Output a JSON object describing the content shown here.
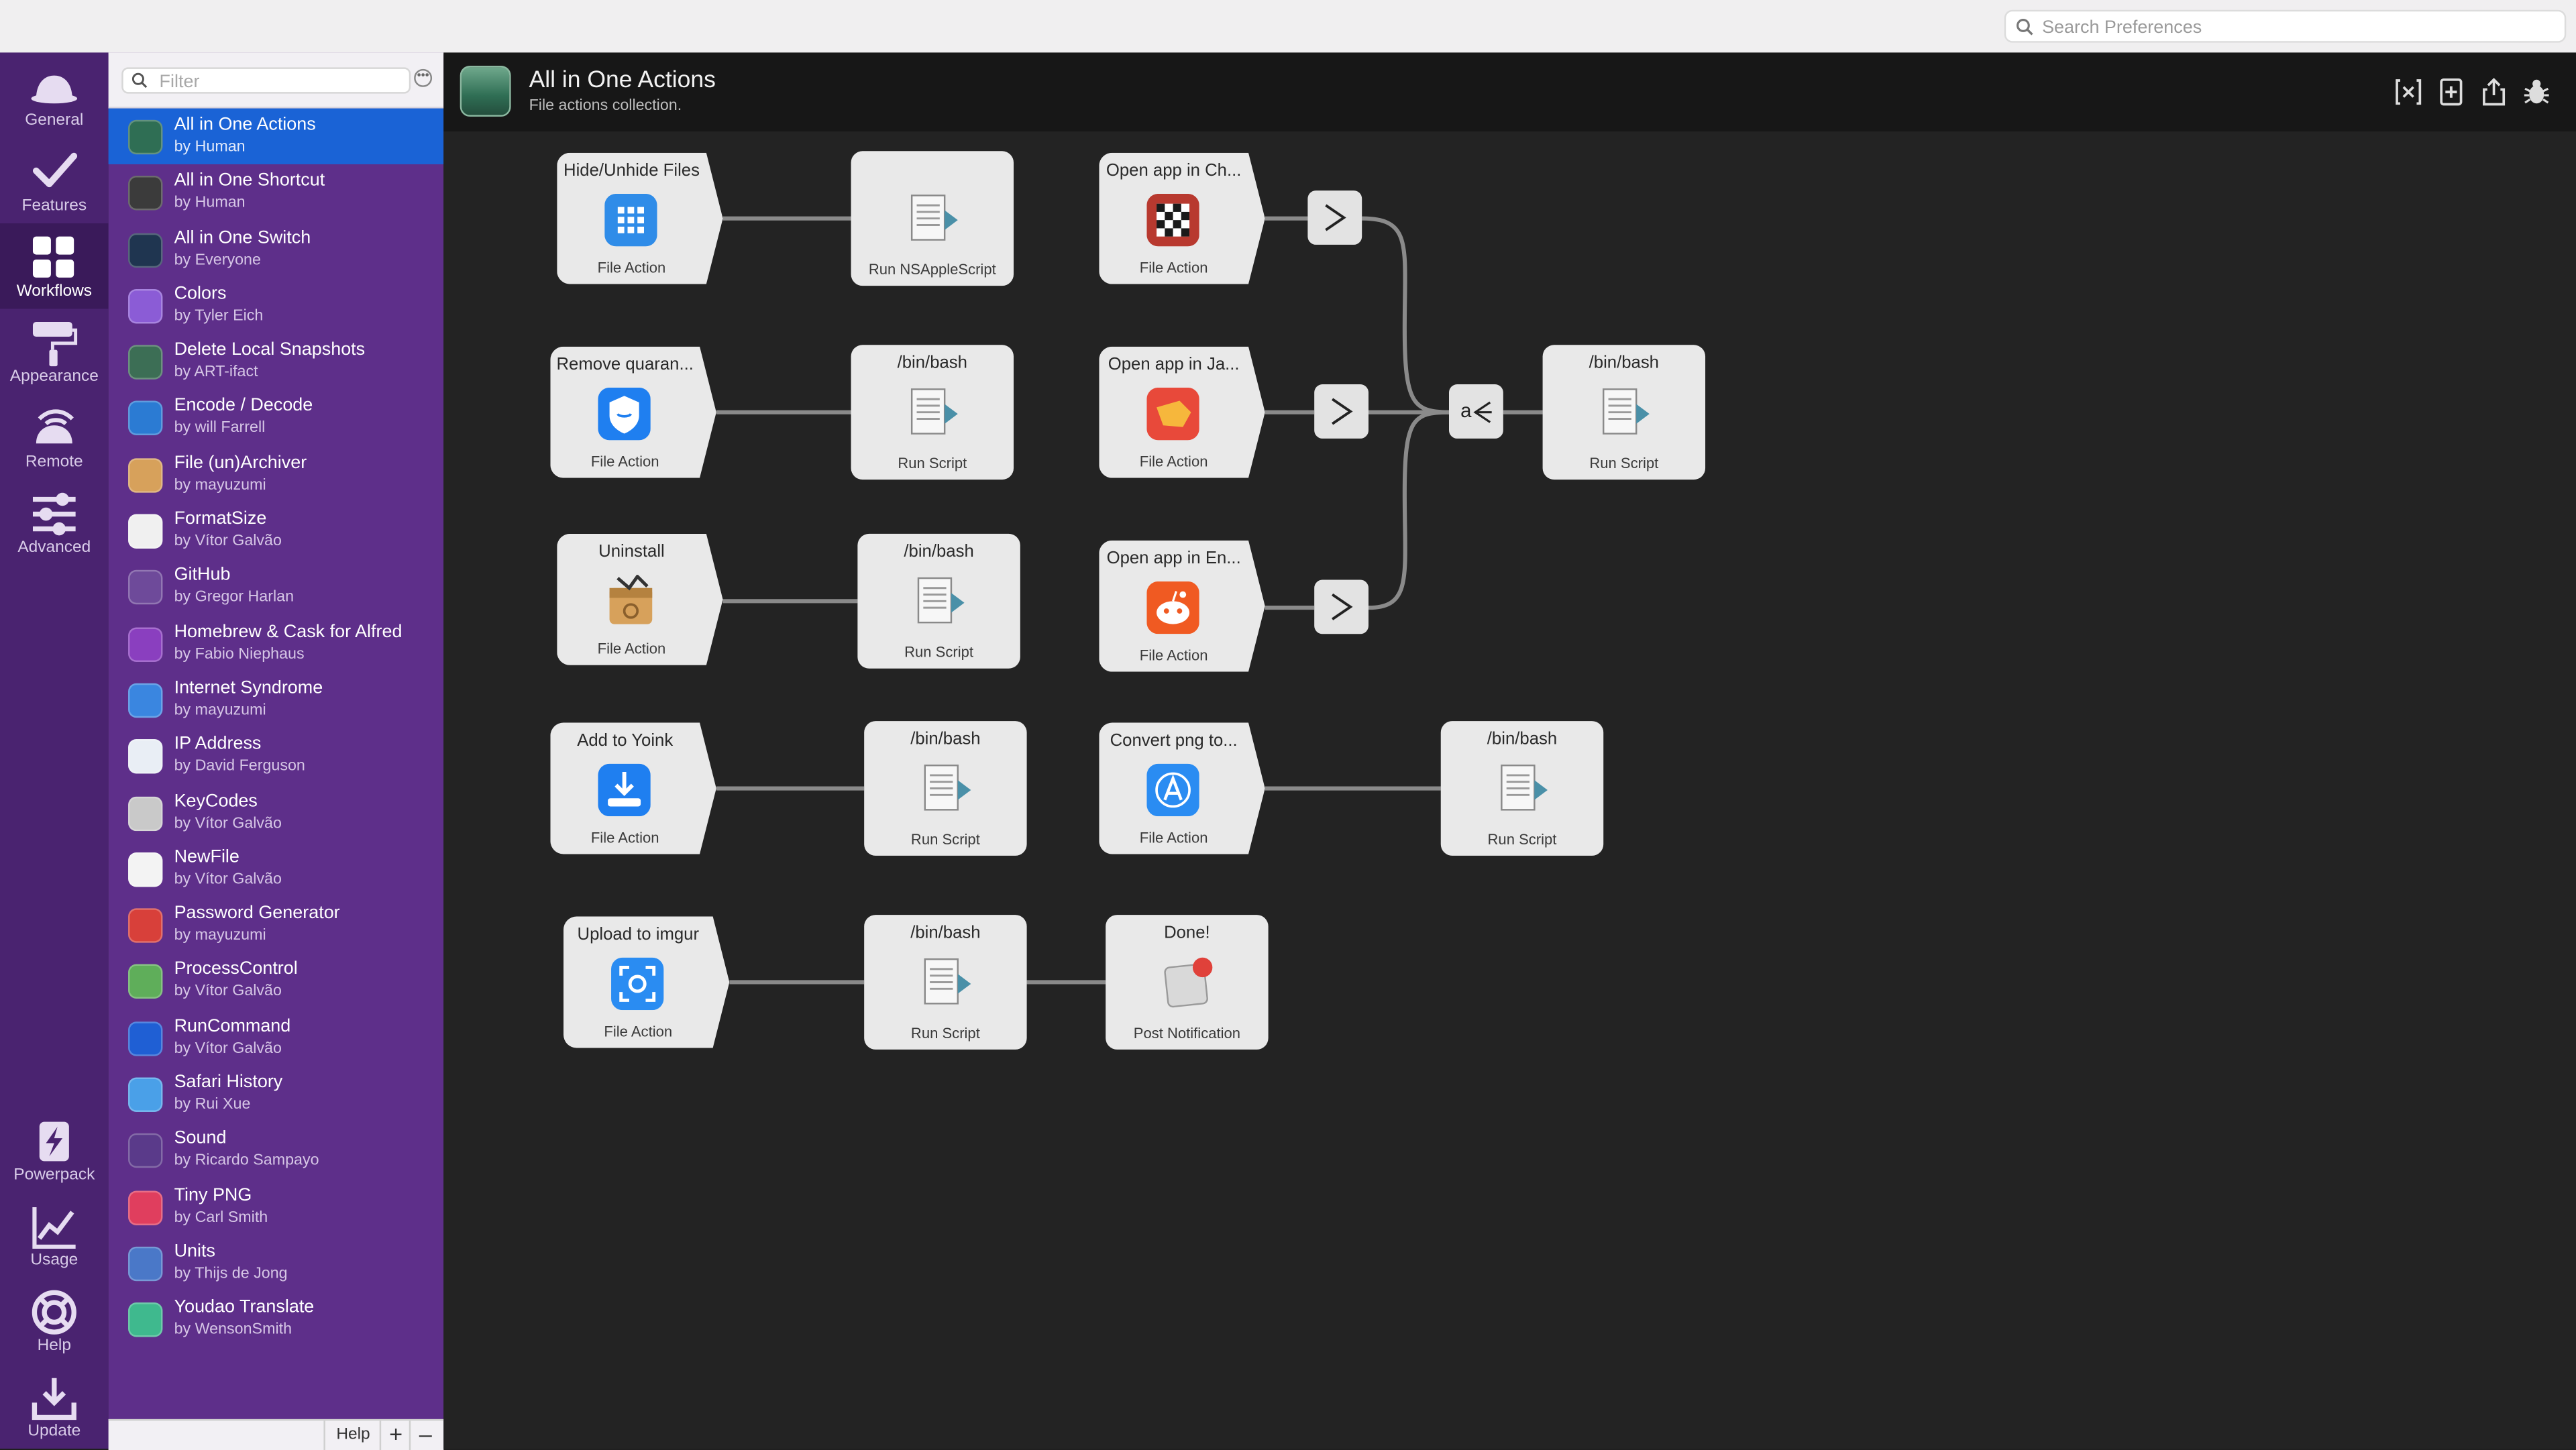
{
  "search": {
    "placeholder": "Search Preferences"
  },
  "nav": {
    "general": "General",
    "features": "Features",
    "workflows": "Workflows",
    "appearance": "Appearance",
    "remote": "Remote",
    "advanced": "Advanced",
    "powerpack": "Powerpack",
    "usage": "Usage",
    "help": "Help",
    "update": "Update"
  },
  "filter": {
    "placeholder": "Filter"
  },
  "workflows": [
    {
      "name": "All in One Actions",
      "author": "by Human",
      "selected": true,
      "color": "#2f6e54"
    },
    {
      "name": "All in One Shortcut",
      "author": "by Human",
      "color": "#3b3b3b"
    },
    {
      "name": "All in One Switch",
      "author": "by Everyone",
      "color": "#1f3550"
    },
    {
      "name": "Colors",
      "author": "by Tyler Eich",
      "color": "#8b5cd6"
    },
    {
      "name": "Delete Local Snapshots",
      "author": "by ART-ifact",
      "color": "#3c6e55"
    },
    {
      "name": "Encode / Decode",
      "author": "by will Farrell",
      "color": "#2b7bd3"
    },
    {
      "name": "File (un)Archiver",
      "author": "by mayuzumi",
      "color": "#d7a15b"
    },
    {
      "name": "FormatSize",
      "author": "by Vítor Galvão",
      "color": "#f0f0f0"
    },
    {
      "name": "GitHub",
      "author": "by Gregor Harlan",
      "color": "#6e4a9a"
    },
    {
      "name": "Homebrew & Cask for Alfred",
      "author": "by Fabio Niephaus",
      "color": "#8a3fbf"
    },
    {
      "name": "Internet Syndrome",
      "author": "by mayuzumi",
      "color": "#3a86e0"
    },
    {
      "name": "IP Address",
      "author": "by David Ferguson",
      "color": "#e9eef5"
    },
    {
      "name": "KeyCodes",
      "author": "by Vítor Galvão",
      "color": "#c9c9c9"
    },
    {
      "name": "NewFile",
      "author": "by Vítor Galvão",
      "color": "#f3f3f3"
    },
    {
      "name": "Password Generator",
      "author": "by mayuzumi",
      "color": "#d8403a"
    },
    {
      "name": "ProcessControl",
      "author": "by Vítor Galvão",
      "color": "#5fae5a"
    },
    {
      "name": "RunCommand",
      "author": "by Vítor Galvão",
      "color": "#1f5fd4"
    },
    {
      "name": "Safari History",
      "author": "by Rui Xue",
      "color": "#4aa0e8"
    },
    {
      "name": "Sound",
      "author": "by Ricardo Sampayo",
      "color": "#5a3a8a"
    },
    {
      "name": "Tiny PNG",
      "author": "by Carl Smith",
      "color": "#e03e5e"
    },
    {
      "name": "Units",
      "author": "by Thijs de Jong",
      "color": "#4a78c8"
    },
    {
      "name": "Youdao Translate",
      "author": "by WensonSmith",
      "color": "#3fb98e"
    }
  ],
  "bottombar": {
    "help": "Help",
    "add": "+",
    "remove": "–"
  },
  "header": {
    "title": "All in One Actions",
    "subtitle": "File actions collection."
  },
  "canvas": {
    "nodes": [
      {
        "id": "hide-unhide",
        "title": "Hide/Unhide Files",
        "type": "File Action",
        "icon": "grid-app-icon"
      },
      {
        "id": "run-nsapplescript",
        "title": "",
        "type": "Run NSAppleScript",
        "icon": "script-icon"
      },
      {
        "id": "open-chrome",
        "title": "Open app in Ch...",
        "type": "File Action",
        "icon": "checker-app-icon"
      },
      {
        "id": "remove-quarantine",
        "title": "Remove quaran...",
        "type": "File Action",
        "icon": "shield-app-icon"
      },
      {
        "id": "bash-1",
        "title": "/bin/bash",
        "type": "Run Script",
        "icon": "script-icon"
      },
      {
        "id": "open-ja",
        "title": "Open app in Ja...",
        "type": "File Action",
        "icon": "ja-app-icon"
      },
      {
        "id": "bash-main",
        "title": "/bin/bash",
        "type": "Run Script",
        "icon": "script-icon"
      },
      {
        "id": "uninstall",
        "title": "Uninstall",
        "type": "File Action",
        "icon": "uninstall-app-icon"
      },
      {
        "id": "bash-2",
        "title": "/bin/bash",
        "type": "Run Script",
        "icon": "script-icon"
      },
      {
        "id": "open-en",
        "title": "Open app in En...",
        "type": "File Action",
        "icon": "reddit-app-icon"
      },
      {
        "id": "add-yoink",
        "title": "Add to Yoink",
        "type": "File Action",
        "icon": "yoink-app-icon"
      },
      {
        "id": "bash-3",
        "title": "/bin/bash",
        "type": "Run Script",
        "icon": "script-icon"
      },
      {
        "id": "convert-png",
        "title": "Convert png to...",
        "type": "File Action",
        "icon": "appstore-icon"
      },
      {
        "id": "bash-4",
        "title": "/bin/bash",
        "type": "Run Script",
        "icon": "script-icon"
      },
      {
        "id": "upload-imgur",
        "title": "Upload to imgur",
        "type": "File Action",
        "icon": "screenshot-app-icon"
      },
      {
        "id": "bash-5",
        "title": "/bin/bash",
        "type": "Run Script",
        "icon": "script-icon"
      },
      {
        "id": "done",
        "title": "Done!",
        "type": "Post Notification",
        "icon": "notification-icon"
      }
    ]
  },
  "colors": {
    "sidebar": "#4a2370",
    "list": "#5e2f8a",
    "selection": "#1a63d6",
    "canvas": "#232323"
  }
}
